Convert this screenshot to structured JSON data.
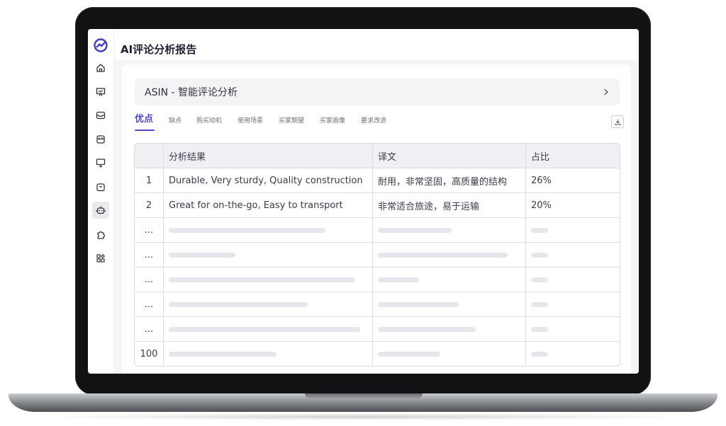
{
  "page": {
    "title": "AI评论分析报告"
  },
  "sidebar": {
    "items": [
      {
        "icon": "home-icon"
      },
      {
        "icon": "presentation-chart-icon"
      },
      {
        "icon": "inbox-icon"
      },
      {
        "icon": "store-icon"
      },
      {
        "icon": "monitor-icon"
      },
      {
        "icon": "shopping-bag-icon"
      },
      {
        "icon": "robot-icon",
        "active": true
      },
      {
        "icon": "puzzle-icon"
      },
      {
        "icon": "apps-grid-icon"
      }
    ]
  },
  "asin_panel": {
    "title": "ASIN - 智能评论分析"
  },
  "tabs": [
    {
      "label": "优点",
      "active": true
    },
    {
      "label": "缺点"
    },
    {
      "label": "购买动机"
    },
    {
      "label": "使用场景"
    },
    {
      "label": "买家期望"
    },
    {
      "label": "买家画像"
    },
    {
      "label": "要求改进"
    }
  ],
  "table": {
    "headers": [
      "",
      "分析结果",
      "译文",
      "占比"
    ],
    "rows": [
      {
        "index": "1",
        "result": "Durable, Very sturdy, Quality construction",
        "translation": "耐用，非常坚固，高质量的结构",
        "share": "26%"
      },
      {
        "index": "2",
        "result": "Great for on-the-go, Easy to transport",
        "translation": "非常适合旅途，易于运输",
        "share": "20%"
      },
      {
        "index": "..."
      },
      {
        "index": "..."
      },
      {
        "index": "..."
      },
      {
        "index": "..."
      },
      {
        "index": "..."
      },
      {
        "index": "100"
      }
    ]
  },
  "colors": {
    "accent": "#4a49c8",
    "header_bg": "#f0f0f4",
    "panel_bg": "#f4f4f6"
  }
}
